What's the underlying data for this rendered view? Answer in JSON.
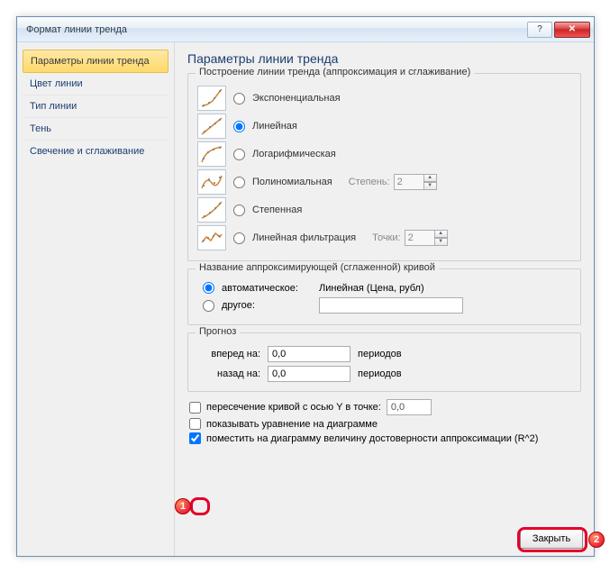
{
  "window": {
    "title": "Формат линии тренда"
  },
  "sidebar": {
    "items": [
      "Параметры линии тренда",
      "Цвет линии",
      "Тип линии",
      "Тень",
      "Свечение и сглаживание"
    ]
  },
  "main": {
    "heading": "Параметры линии тренда",
    "build": {
      "legend": "Построение линии тренда (аппроксимация и сглаживание)",
      "opts": {
        "exp": "Экспоненциальная",
        "lin": "Линейная",
        "log": "Логарифмическая",
        "poly": "Полиномиальная",
        "power": "Степенная",
        "movavg": "Линейная фильтрация"
      },
      "degree_label": "Степень:",
      "degree_value": "2",
      "period_label": "Точки:",
      "period_value": "2"
    },
    "name": {
      "legend": "Название аппроксимирующей (сглаженной) кривой",
      "auto": "автоматическое:",
      "auto_value": "Линейная (Цена, рубл)",
      "other": "другое:"
    },
    "forecast": {
      "legend": "Прогноз",
      "forward": "вперед на:",
      "backward": "назад на:",
      "forward_val": "0,0",
      "backward_val": "0,0",
      "periods": "периодов"
    },
    "checks": {
      "intercept": "пересечение кривой с осью Y в точке:",
      "intercept_val": "0,0",
      "equation": "показывать уравнение на диаграмме",
      "r2": "поместить на диаграмму величину достоверности аппроксимации (R^2)"
    },
    "close": "Закрыть"
  },
  "badges": {
    "one": "1",
    "two": "2"
  }
}
